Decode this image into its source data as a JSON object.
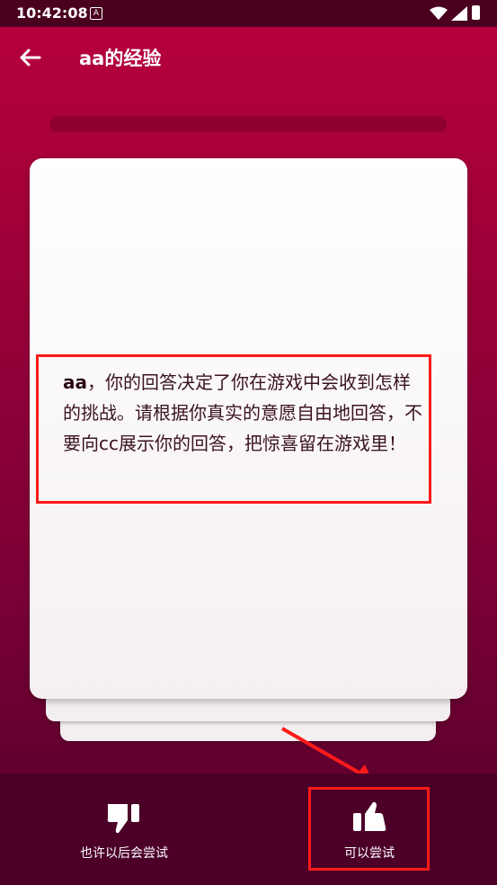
{
  "status_bar": {
    "time": "10:42:08",
    "notification_icon": "A"
  },
  "app_bar": {
    "title": "aa的经验",
    "back_icon": "arrow-left-icon"
  },
  "card": {
    "name": "aa",
    "message": "，你的回答决定了你在游戏中会收到怎样的挑战。请根据你真实的意愿自由地回答，不要向cc展示你的回答，把惊喜留在游戏里！"
  },
  "actions": {
    "maybe_later_label": "也许以后会尝试",
    "maybe_later_icon": "thumbs-down-icon",
    "can_try_label": "可以尝试",
    "can_try_icon": "thumbs-up-icon"
  },
  "colors": {
    "background_top": "#b8003e",
    "background_bottom": "#61002f",
    "bottom_bar": "#4c0028",
    "annotation_red": "#ff1a1a"
  }
}
